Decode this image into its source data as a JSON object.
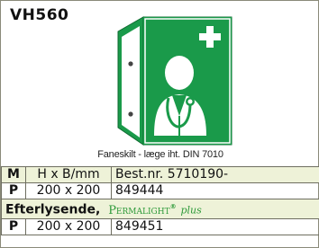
{
  "product": {
    "code": "VH560",
    "caption": "Faneskilt - læge iht. DIN 7010",
    "icon": "doctor-stethoscope-cross"
  },
  "table": {
    "headers": [
      "M",
      "H x B/mm",
      "Best.nr. 5710190-"
    ],
    "rows": [
      {
        "m": "P",
        "size": "200 x 200",
        "number": "849444"
      }
    ],
    "band": {
      "label": "Efterlysende,",
      "brand": "Permalight",
      "trademark": "®",
      "suffix": "plus"
    },
    "rows_band": [
      {
        "m": "P",
        "size": "200 x 200",
        "number": "849451"
      }
    ]
  },
  "colors": {
    "sign_green": "#1a9a4a",
    "band_bg": "#eef2d8",
    "brand_green": "#2e9a3a"
  }
}
